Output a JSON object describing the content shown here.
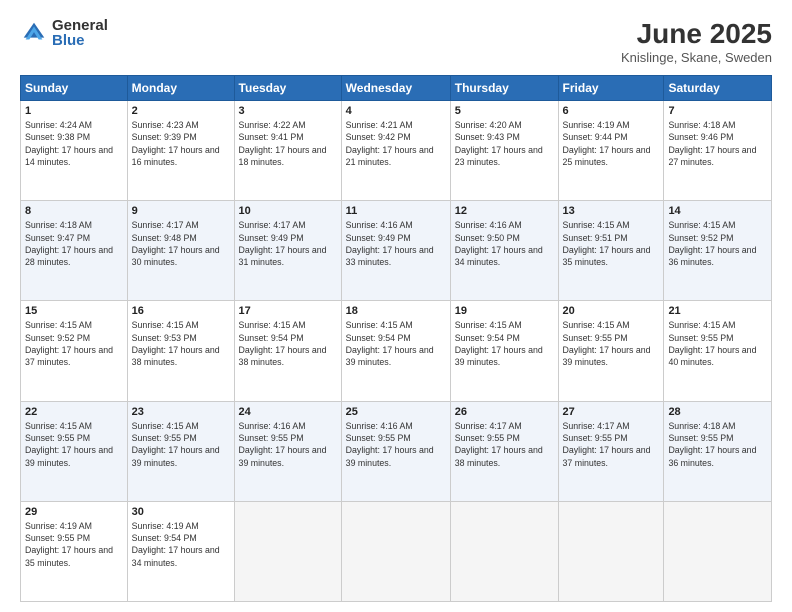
{
  "logo": {
    "general": "General",
    "blue": "Blue"
  },
  "header": {
    "month_year": "June 2025",
    "location": "Knislinge, Skane, Sweden"
  },
  "weekdays": [
    "Sunday",
    "Monday",
    "Tuesday",
    "Wednesday",
    "Thursday",
    "Friday",
    "Saturday"
  ],
  "weeks": [
    [
      {
        "day": 1,
        "sunrise": "4:24 AM",
        "sunset": "9:38 PM",
        "daylight": "17 hours and 14 minutes."
      },
      {
        "day": 2,
        "sunrise": "4:23 AM",
        "sunset": "9:39 PM",
        "daylight": "17 hours and 16 minutes."
      },
      {
        "day": 3,
        "sunrise": "4:22 AM",
        "sunset": "9:41 PM",
        "daylight": "17 hours and 18 minutes."
      },
      {
        "day": 4,
        "sunrise": "4:21 AM",
        "sunset": "9:42 PM",
        "daylight": "17 hours and 21 minutes."
      },
      {
        "day": 5,
        "sunrise": "4:20 AM",
        "sunset": "9:43 PM",
        "daylight": "17 hours and 23 minutes."
      },
      {
        "day": 6,
        "sunrise": "4:19 AM",
        "sunset": "9:44 PM",
        "daylight": "17 hours and 25 minutes."
      },
      {
        "day": 7,
        "sunrise": "4:18 AM",
        "sunset": "9:46 PM",
        "daylight": "17 hours and 27 minutes."
      }
    ],
    [
      {
        "day": 8,
        "sunrise": "4:18 AM",
        "sunset": "9:47 PM",
        "daylight": "17 hours and 28 minutes."
      },
      {
        "day": 9,
        "sunrise": "4:17 AM",
        "sunset": "9:48 PM",
        "daylight": "17 hours and 30 minutes."
      },
      {
        "day": 10,
        "sunrise": "4:17 AM",
        "sunset": "9:49 PM",
        "daylight": "17 hours and 31 minutes."
      },
      {
        "day": 11,
        "sunrise": "4:16 AM",
        "sunset": "9:49 PM",
        "daylight": "17 hours and 33 minutes."
      },
      {
        "day": 12,
        "sunrise": "4:16 AM",
        "sunset": "9:50 PM",
        "daylight": "17 hours and 34 minutes."
      },
      {
        "day": 13,
        "sunrise": "4:15 AM",
        "sunset": "9:51 PM",
        "daylight": "17 hours and 35 minutes."
      },
      {
        "day": 14,
        "sunrise": "4:15 AM",
        "sunset": "9:52 PM",
        "daylight": "17 hours and 36 minutes."
      }
    ],
    [
      {
        "day": 15,
        "sunrise": "4:15 AM",
        "sunset": "9:52 PM",
        "daylight": "17 hours and 37 minutes."
      },
      {
        "day": 16,
        "sunrise": "4:15 AM",
        "sunset": "9:53 PM",
        "daylight": "17 hours and 38 minutes."
      },
      {
        "day": 17,
        "sunrise": "4:15 AM",
        "sunset": "9:54 PM",
        "daylight": "17 hours and 38 minutes."
      },
      {
        "day": 18,
        "sunrise": "4:15 AM",
        "sunset": "9:54 PM",
        "daylight": "17 hours and 39 minutes."
      },
      {
        "day": 19,
        "sunrise": "4:15 AM",
        "sunset": "9:54 PM",
        "daylight": "17 hours and 39 minutes."
      },
      {
        "day": 20,
        "sunrise": "4:15 AM",
        "sunset": "9:55 PM",
        "daylight": "17 hours and 39 minutes."
      },
      {
        "day": 21,
        "sunrise": "4:15 AM",
        "sunset": "9:55 PM",
        "daylight": "17 hours and 40 minutes."
      }
    ],
    [
      {
        "day": 22,
        "sunrise": "4:15 AM",
        "sunset": "9:55 PM",
        "daylight": "17 hours and 39 minutes."
      },
      {
        "day": 23,
        "sunrise": "4:15 AM",
        "sunset": "9:55 PM",
        "daylight": "17 hours and 39 minutes."
      },
      {
        "day": 24,
        "sunrise": "4:16 AM",
        "sunset": "9:55 PM",
        "daylight": "17 hours and 39 minutes."
      },
      {
        "day": 25,
        "sunrise": "4:16 AM",
        "sunset": "9:55 PM",
        "daylight": "17 hours and 39 minutes."
      },
      {
        "day": 26,
        "sunrise": "4:17 AM",
        "sunset": "9:55 PM",
        "daylight": "17 hours and 38 minutes."
      },
      {
        "day": 27,
        "sunrise": "4:17 AM",
        "sunset": "9:55 PM",
        "daylight": "17 hours and 37 minutes."
      },
      {
        "day": 28,
        "sunrise": "4:18 AM",
        "sunset": "9:55 PM",
        "daylight": "17 hours and 36 minutes."
      }
    ],
    [
      {
        "day": 29,
        "sunrise": "4:19 AM",
        "sunset": "9:55 PM",
        "daylight": "17 hours and 35 minutes."
      },
      {
        "day": 30,
        "sunrise": "4:19 AM",
        "sunset": "9:54 PM",
        "daylight": "17 hours and 34 minutes."
      },
      null,
      null,
      null,
      null,
      null
    ]
  ]
}
